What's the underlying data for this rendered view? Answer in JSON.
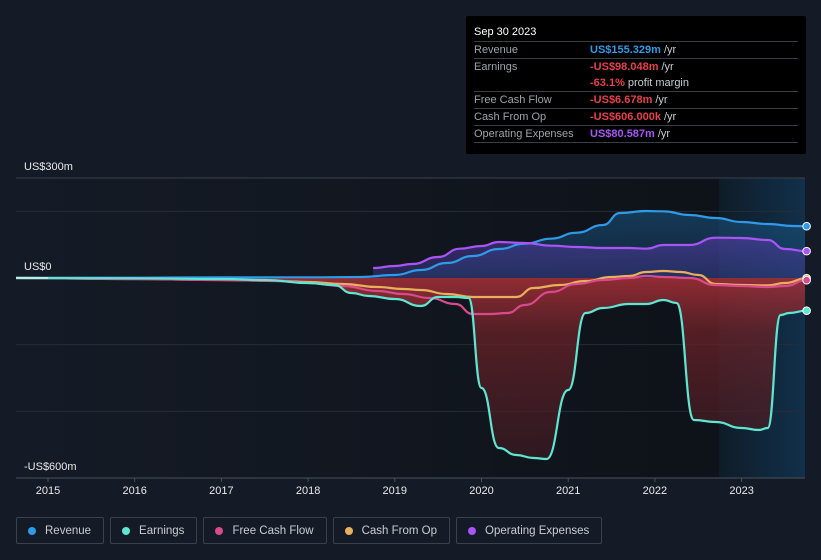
{
  "tooltip": {
    "date": "Sep 30 2023",
    "rows": [
      {
        "label": "Revenue",
        "value": "US$155.329m",
        "unit": "/yr",
        "color": "#2e9ae8"
      },
      {
        "label": "Earnings",
        "value": "-US$98.048m",
        "unit": "/yr",
        "color": "#e8404a"
      },
      {
        "label": "",
        "value": "-63.1%",
        "unit": "profit margin",
        "color": "#e8404a"
      },
      {
        "label": "Free Cash Flow",
        "value": "-US$6.678m",
        "unit": "/yr",
        "color": "#e8404a"
      },
      {
        "label": "Cash From Op",
        "value": "-US$606.000k",
        "unit": "/yr",
        "color": "#e8404a"
      },
      {
        "label": "Operating Expenses",
        "value": "US$80.587m",
        "unit": "/yr",
        "color": "#a855f7"
      }
    ]
  },
  "legend": [
    {
      "label": "Revenue",
      "color": "#2e9ae8"
    },
    {
      "label": "Earnings",
      "color": "#5ee6d2"
    },
    {
      "label": "Free Cash Flow",
      "color": "#d94a8c"
    },
    {
      "label": "Cash From Op",
      "color": "#e8b05c"
    },
    {
      "label": "Operating Expenses",
      "color": "#a855f7"
    }
  ],
  "chart_data": {
    "type": "line",
    "title": "",
    "xlabel": "",
    "ylabel": "",
    "ylim": [
      -600,
      300
    ],
    "xlim": [
      2014.62,
      2023.75
    ],
    "y_tick_labels": [
      {
        "value": 300,
        "label": "US$300m"
      },
      {
        "value": 0,
        "label": "US$0"
      },
      {
        "value": -600,
        "label": "-US$600m"
      }
    ],
    "gridlines": [
      300,
      200,
      0,
      -200,
      -400,
      -600
    ],
    "x_tick_labels": [
      "2015",
      "2016",
      "2017",
      "2018",
      "2019",
      "2020",
      "2021",
      "2022",
      "2023"
    ],
    "x_ticks": [
      2015,
      2016,
      2017,
      2018,
      2019,
      2020,
      2021,
      2022,
      2023
    ],
    "highlight_from": 2022.74,
    "units": "US$m",
    "series": [
      {
        "name": "Revenue",
        "color": "#2e9ae8",
        "fill": true,
        "x": [
          2014.62,
          2016.0,
          2017.0,
          2018.0,
          2018.6,
          2019.0,
          2019.3,
          2019.6,
          2019.9,
          2020.2,
          2020.5,
          2020.8,
          2021.1,
          2021.4,
          2021.6,
          2021.9,
          2022.1,
          2022.4,
          2022.7,
          2023.0,
          2023.3,
          2023.6,
          2023.75
        ],
        "y": [
          1,
          1,
          2,
          2,
          3,
          9,
          24,
          45,
          66,
          87,
          103,
          118,
          136,
          159,
          195,
          201,
          200,
          189,
          180,
          168,
          162,
          156,
          155.3
        ]
      },
      {
        "name": "Operating Expenses",
        "color": "#a855f7",
        "fill": true,
        "x": [
          2018.75,
          2019.0,
          2019.2,
          2019.5,
          2019.75,
          2020.0,
          2020.2,
          2020.5,
          2020.8,
          2021.1,
          2021.4,
          2021.7,
          2021.9,
          2022.1,
          2022.4,
          2022.7,
          2023.0,
          2023.3,
          2023.5,
          2023.75
        ],
        "y": [
          30,
          36,
          42,
          63,
          88,
          96,
          108,
          105,
          97,
          93,
          90,
          90,
          88,
          99,
          99,
          121,
          120,
          114,
          87,
          80.6
        ]
      },
      {
        "name": "Cash From Op",
        "color": "#e8b05c",
        "fill": false,
        "x": [
          2014.62,
          2016.0,
          2017.0,
          2017.7,
          2018.0,
          2018.4,
          2018.8,
          2019.1,
          2019.3,
          2019.6,
          2019.9,
          2020.2,
          2020.4,
          2020.6,
          2020.9,
          2021.2,
          2021.5,
          2021.7,
          2021.9,
          2022.1,
          2022.3,
          2022.5,
          2022.7,
          2023.0,
          2023.3,
          2023.5,
          2023.75
        ],
        "y": [
          0,
          -3,
          -6,
          -9,
          -12,
          -18,
          -27,
          -33,
          -36,
          -48,
          -57,
          -57,
          -57,
          -30,
          -21,
          -9,
          3,
          6,
          18,
          21,
          18,
          9,
          -18,
          -21,
          -22,
          -15,
          -0.6
        ]
      },
      {
        "name": "Free Cash Flow",
        "color": "#d94a8c",
        "fill": false,
        "x": [
          2014.62,
          2016.0,
          2017.0,
          2017.7,
          2018.0,
          2018.4,
          2018.8,
          2019.1,
          2019.4,
          2019.7,
          2019.9,
          2020.1,
          2020.3,
          2020.5,
          2020.8,
          2021.1,
          2021.4,
          2021.7,
          2021.9,
          2022.1,
          2022.4,
          2022.7,
          2023.0,
          2023.3,
          2023.5,
          2023.75
        ],
        "y": [
          0,
          -3,
          -6,
          -9,
          -15,
          -24,
          -39,
          -48,
          -60,
          -78,
          -108,
          -108,
          -105,
          -81,
          -42,
          -18,
          -6,
          0,
          6,
          3,
          0,
          -21,
          -24,
          -27,
          -24,
          -6.7
        ]
      },
      {
        "name": "Earnings",
        "color": "#5ee6d2",
        "fill": true,
        "x": [
          2014.62,
          2016.0,
          2017.0,
          2017.5,
          2018.0,
          2018.3,
          2018.5,
          2018.7,
          2019.0,
          2019.3,
          2019.5,
          2019.7,
          2019.85,
          2020.0,
          2020.2,
          2020.4,
          2020.6,
          2020.75,
          2021.0,
          2021.2,
          2021.4,
          2021.7,
          2021.9,
          2022.1,
          2022.25,
          2022.45,
          2022.7,
          2023.0,
          2023.2,
          2023.3,
          2023.45,
          2023.55,
          2023.75
        ],
        "y": [
          0,
          -1,
          -3,
          -6,
          -15,
          -21,
          -45,
          -54,
          -63,
          -84,
          -57,
          -57,
          -60,
          -330,
          -510,
          -531,
          -540,
          -543,
          -336,
          -105,
          -90,
          -78,
          -78,
          -66,
          -75,
          -426,
          -432,
          -450,
          -456,
          -450,
          -111,
          -105,
          -98
        ]
      }
    ]
  }
}
